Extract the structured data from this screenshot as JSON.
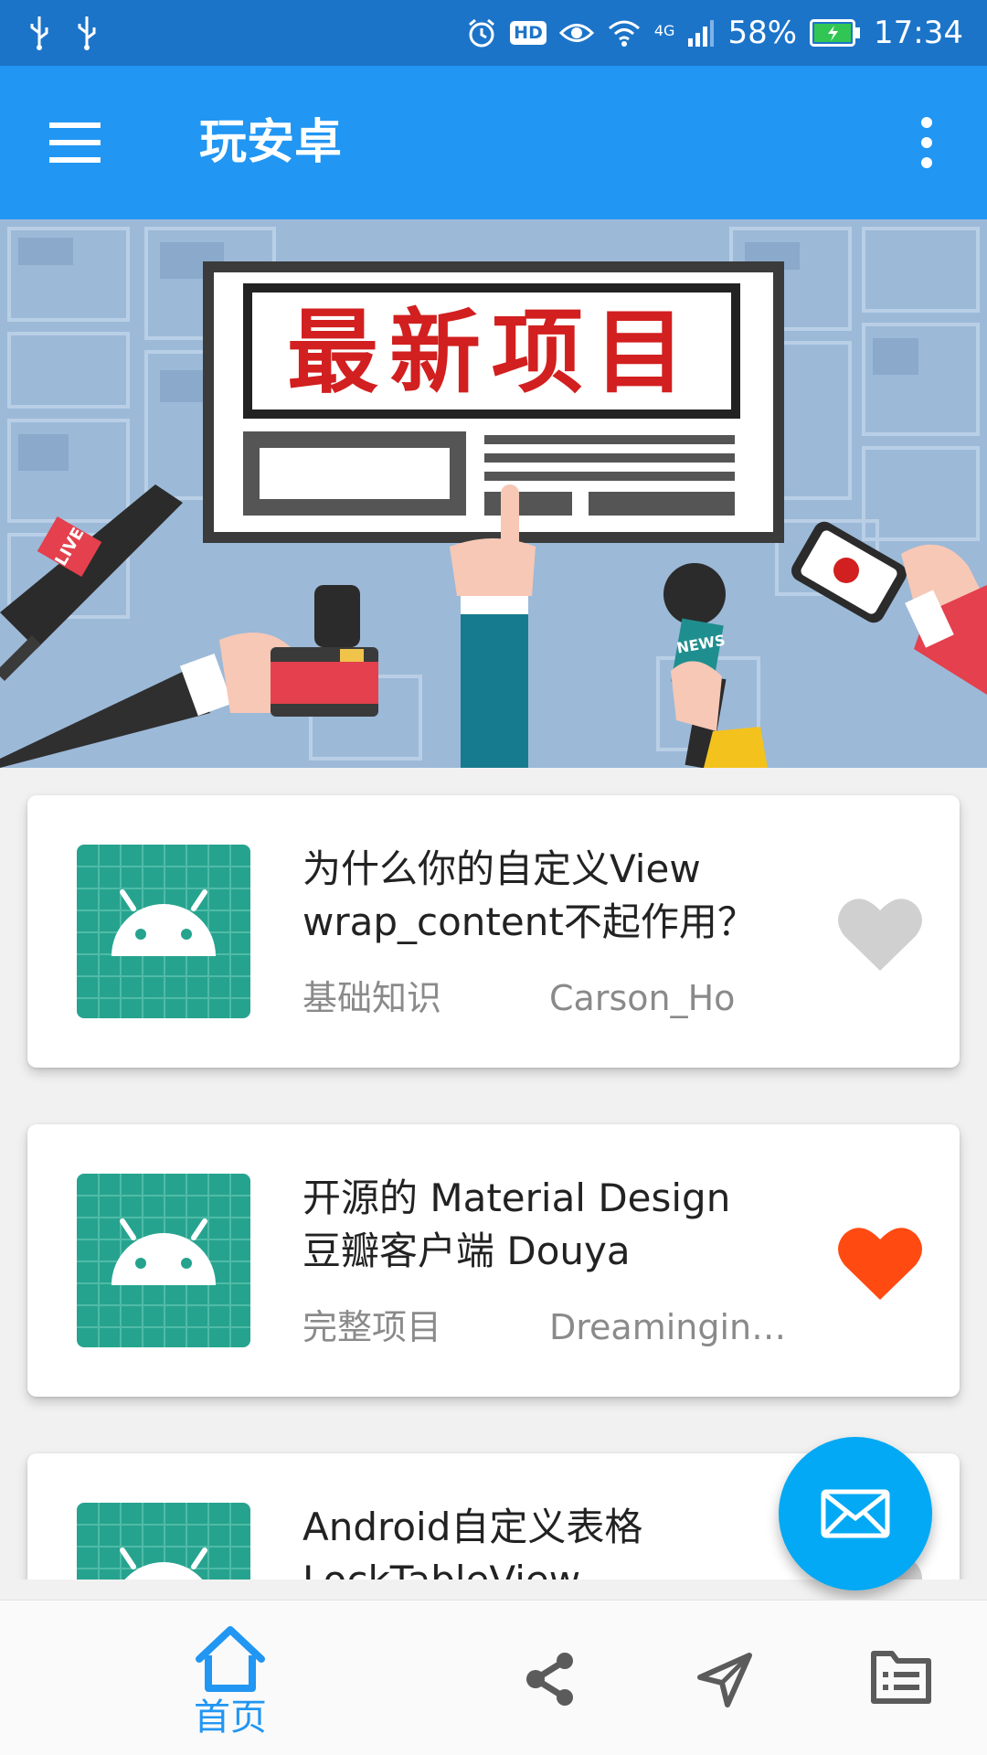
{
  "status_bar": {
    "battery": "58%",
    "time": "17:34",
    "network": "4G",
    "hd_badge": "HD"
  },
  "toolbar": {
    "title": "玩安卓",
    "menu_icon": "hamburger-menu-icon",
    "more_icon": "more-vertical-icon"
  },
  "banner": {
    "headline": "最新项目",
    "badge_live": "LIVE",
    "badge_news": "NEWS"
  },
  "articles": [
    {
      "title": "为什么你的自定义View\nwrap_content不起作用？",
      "chapter": "基础知识",
      "author": "Carson_Ho",
      "favorite": false
    },
    {
      "title": "开源的 Material Design\n豆瓣客户端 Douya",
      "chapter": "完整项目",
      "author": "DreaminginC…",
      "favorite": true
    },
    {
      "title": "Android自定义表格\nLockTableView",
      "chapter": "",
      "author": "",
      "favorite": false
    }
  ],
  "colors": {
    "status_bar": "#1c74c9",
    "toolbar": "#2196f3",
    "fab": "#03a9f4",
    "favorite_on": "#ff4a12",
    "favorite_off": "#d0d0d0",
    "thumb": "#26a38f",
    "nav_active": "#2196f3",
    "nav_inactive": "#5b5b5b"
  },
  "fab": {
    "icon": "mail-icon"
  },
  "bottom_nav": {
    "items": [
      {
        "label": "首页",
        "icon": "home-icon",
        "active": true
      },
      {
        "icon": "share-icon"
      },
      {
        "icon": "navigation-icon"
      },
      {
        "icon": "list-icon"
      }
    ]
  }
}
